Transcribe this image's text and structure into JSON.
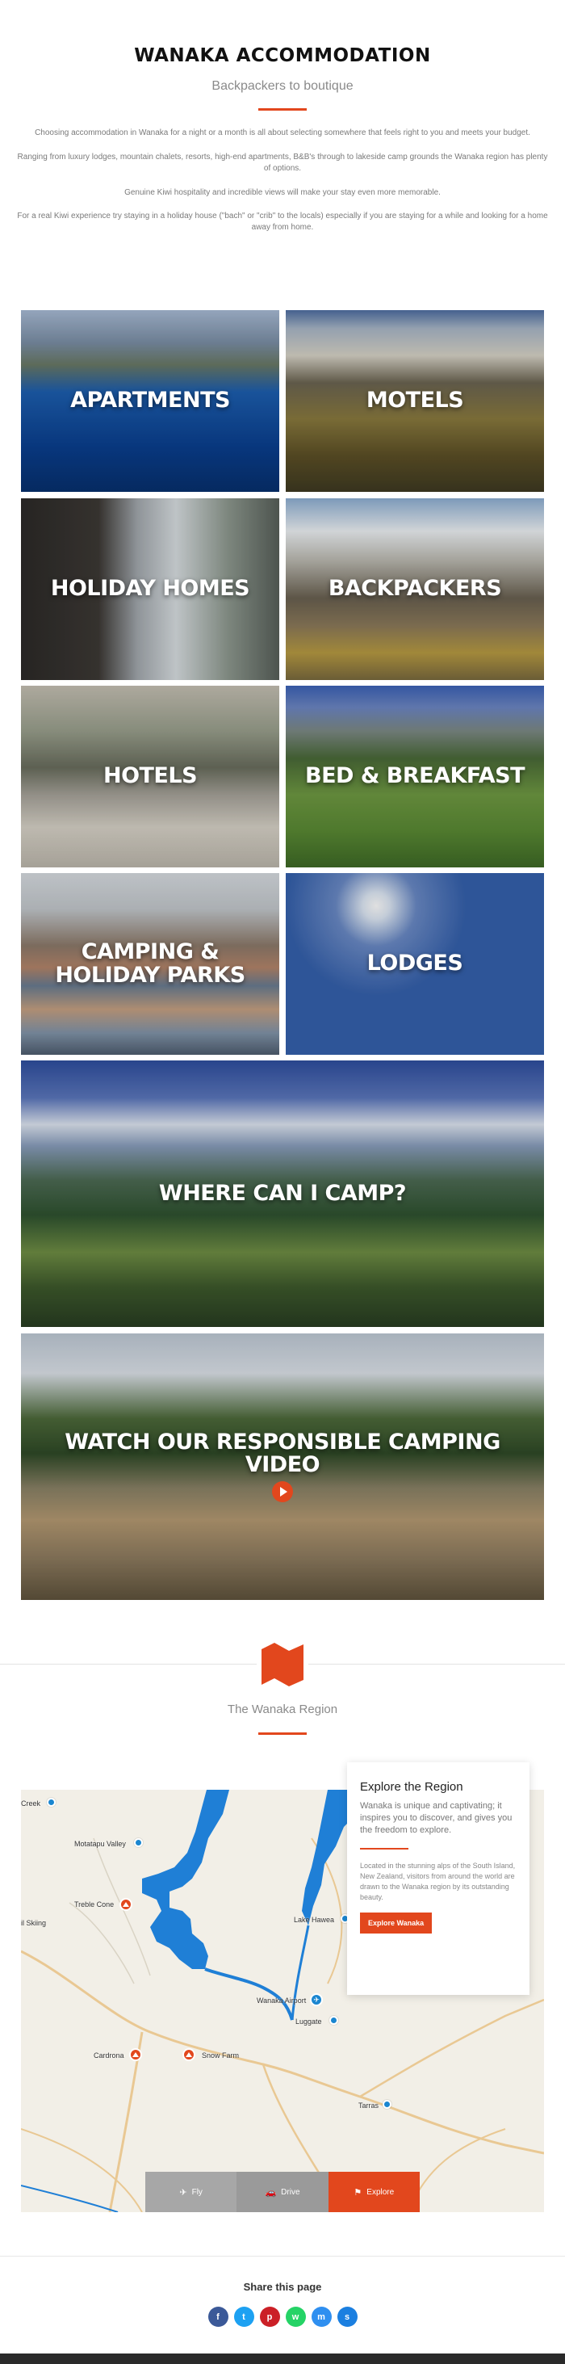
{
  "header": {
    "title": "WANAKA ACCOMMODATION",
    "subtitle": "Backpackers to boutique",
    "paragraphs": [
      "Choosing accommodation in Wanaka for a night or a month is all about selecting somewhere that feels right to you and meets your budget.",
      "Ranging from luxury lodges, mountain chalets, resorts, high-end apartments, B&B's through to lakeside camp grounds the Wanaka region has plenty of options.",
      "Genuine Kiwi hospitality and incredible views will make your stay even more memorable.",
      "For a real Kiwi experience try staying in a holiday house (\"bach\" or \"crib\" to the locals) especially if you are staying for a while and looking for a home away from home."
    ]
  },
  "tiles": {
    "apartments": "APARTMENTS",
    "motels": "MOTELS",
    "holiday_homes": "HOLIDAY HOMES",
    "backpackers": "BACKPACKERS",
    "hotels": "HOTELS",
    "bnb": "BED & BREAKFAST",
    "camping": "CAMPING & HOLIDAY PARKS",
    "lodges": "LODGES",
    "where_camp": "WHERE CAN I CAMP?",
    "video": "WATCH OUR RESPONSIBLE CAMPING VIDEO"
  },
  "region": {
    "title": "The Wanaka Region",
    "icon": "map-flag-icon"
  },
  "map": {
    "labels": {
      "creek": "Creek",
      "makarora": "Motatapu Valley",
      "treble_cone": "Treble Cone",
      "skiing": "il Skiing",
      "lake_hawea": "Lake Hawea",
      "airport": "Wanaka Airport",
      "luggate": "Luggate",
      "cardrona": "Cardrona",
      "snow_farm": "Snow Farm",
      "tarras": "Tarras"
    },
    "colors": {
      "water": "#1f7fd6",
      "land": "#f2efe7",
      "road": "#e9c893",
      "accent": "#e2471d"
    }
  },
  "explore": {
    "title": "Explore the Region",
    "lead": "Wanaka is unique and captivating; it inspires you to discover, and gives you the freedom to explore.",
    "body": "Located in the stunning alps of the South Island, New Zealand, visitors from around the world are drawn to the Wanaka region by its outstanding beauty.",
    "button": "Explore Wanaka"
  },
  "map_tabs": {
    "fly": "Fly",
    "drive": "Drive",
    "explore": "Explore"
  },
  "share": {
    "title": "Share this page",
    "buttons": [
      {
        "name": "facebook",
        "glyph": "f",
        "color": "#3b5998"
      },
      {
        "name": "twitter",
        "glyph": "t",
        "color": "#1da1f2"
      },
      {
        "name": "pinterest",
        "glyph": "p",
        "color": "#cb2027"
      },
      {
        "name": "whatsapp",
        "glyph": "w",
        "color": "#25d366"
      },
      {
        "name": "messenger",
        "glyph": "m",
        "color": "#2f8ff0"
      },
      {
        "name": "sms",
        "glyph": "s",
        "color": "#1b7fe0"
      }
    ]
  }
}
